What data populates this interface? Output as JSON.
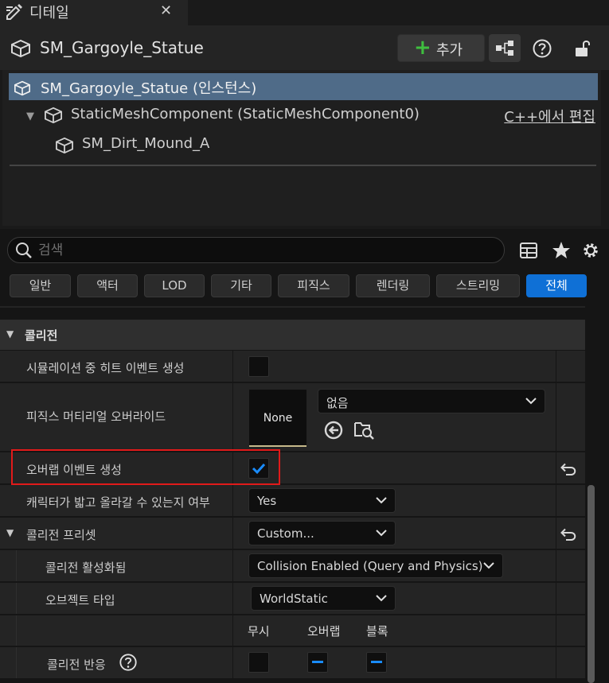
{
  "tab": {
    "icon": "edit-pencil-icon",
    "title": "디테일",
    "close_label": "✕"
  },
  "header": {
    "actor_name": "SM_Gargoyle_Statue",
    "add_button": "추가",
    "icons": [
      "blueprint-icon",
      "help-icon",
      "lock-icon"
    ]
  },
  "tree": {
    "root": "SM_Gargoyle_Statue (인스턴스)",
    "component": "StaticMeshComponent (StaticMeshComponent0)",
    "edit_in_cpp": "C++에서 편집",
    "child": "SM_Dirt_Mound_A"
  },
  "search": {
    "placeholder": "검색",
    "value": ""
  },
  "filters": [
    {
      "label": "일반",
      "active": false
    },
    {
      "label": "액터",
      "active": false
    },
    {
      "label": "LOD",
      "active": false
    },
    {
      "label": "기타",
      "active": false
    },
    {
      "label": "피직스",
      "active": false
    },
    {
      "label": "렌더링",
      "active": false
    },
    {
      "label": "스트리밍",
      "active": false
    },
    {
      "label": "전체",
      "active": true
    }
  ],
  "collision": {
    "category": "콜리전",
    "sim_hit_events": {
      "label": "시뮬레이션 중 히트 이벤트 생성",
      "checked": false
    },
    "phys_mat_override": {
      "label": "피직스 머티리얼 오버라이드",
      "thumb": "None",
      "value": "없음"
    },
    "overlap_events": {
      "label": "오버랩 이벤트 생성",
      "checked": true
    },
    "can_step_up": {
      "label": "캐릭터가 밟고 올라갈 수 있는지 여부",
      "value": "Yes"
    },
    "preset": {
      "label": "콜리전 프리셋",
      "value": "Custom..."
    },
    "enabled": {
      "label": "콜리전 활성화됨",
      "value": "Collision Enabled (Query and Physics)"
    },
    "object_type": {
      "label": "오브젝트 타입",
      "value": "WorldStatic"
    },
    "response_headers": {
      "ignore": "무시",
      "overlap": "오버랩",
      "block": "블록"
    },
    "responses": {
      "label": "콜리전 반응"
    }
  },
  "colors": {
    "accent": "#0f70d6",
    "selection": "#4f6b88",
    "highlight": "#e11a1a",
    "add_plus": "#3fbf3f"
  }
}
